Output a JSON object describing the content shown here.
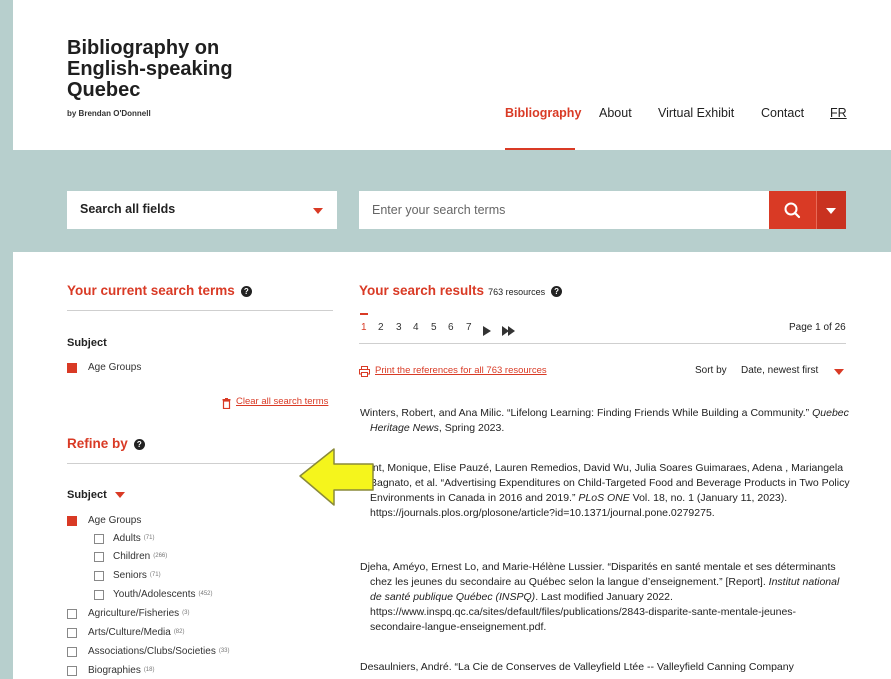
{
  "header": {
    "title": "Bibliography on English-speaking Quebec",
    "byline": "by Brendan O'Donnell",
    "nav": [
      "Bibliography",
      "About",
      "Virtual Exhibit",
      "Contact",
      "FR"
    ]
  },
  "search": {
    "field_select": "Search all fields",
    "placeholder": "Enter your search terms"
  },
  "current_terms": {
    "heading": "Your current search terms",
    "group_label": "Subject",
    "term": "Age Groups",
    "clear_label": "Clear all search terms"
  },
  "refine": {
    "heading": "Refine by",
    "subject_label": "Subject",
    "selected_group": "Age Groups",
    "sub_items": [
      {
        "label": "Adults",
        "count": "(71)"
      },
      {
        "label": "Children",
        "count": "(266)"
      },
      {
        "label": "Seniors",
        "count": "(71)"
      },
      {
        "label": "Youth/Adolescents",
        "count": "(452)"
      }
    ],
    "items": [
      {
        "label": "Agriculture/Fisheries",
        "count": "(3)"
      },
      {
        "label": "Arts/Culture/Media",
        "count": "(82)"
      },
      {
        "label": "Associations/Clubs/Societies",
        "count": "(33)"
      },
      {
        "label": "Biographies",
        "count": "(18)"
      }
    ]
  },
  "results": {
    "heading": "Your search results",
    "count": "763 resources",
    "pages": [
      "1",
      "2",
      "3",
      "4",
      "5",
      "6",
      "7"
    ],
    "page_info": "Page 1 of 26",
    "print_link": "Print the references for all 763 resources",
    "sort_label": "Sort by",
    "sort_value": "Date, newest first",
    "entries": [
      {
        "before": "Winters, Robert, and Ana Milic. “Lifelong Learning: Finding Friends While Building a Community.” ",
        "italic": "Quebec Heritage News",
        "after": ", Spring 2023."
      },
      {
        "before": "Kent, Monique, Elise Pauzé, Lauren Remedios, David Wu, Julia Soares Guimaraes, Adena , Mariangela Bagnato, et al. “Advertising Expenditures on Child-Targeted Food and Beverage Products in Two Policy Environments in Canada in 2016 and 2019.” ",
        "italic": "PLoS ONE",
        "after": " Vol. 18, no. 1 (January 11, 2023). https://journals.plos.org/plosone/article?id=10.1371/journal.pone.0279275."
      },
      {
        "before": "Djeha, Améyo, Ernest Lo, and Marie-Hélène Lussier. “Disparités en santé mentale et ses déterminants chez les jeunes du secondaire au Québec selon la langue d’enseignement.” [Report]. ",
        "italic": "Institut national de santé publique Québec (INSPQ)",
        "after": ". Last modified January 2022. https://www.inspq.qc.ca/sites/default/files/publications/2843-disparite-sante-mentale-jeunes-secondaire-langue-enseignement.pdf."
      },
      {
        "before": "Desaulniers, André. “La Cie de Conserves de Valleyfield Ltée -- Valleyfield Canning Company",
        "italic": "",
        "after": ""
      }
    ]
  },
  "colors": {
    "accent": "#d93a25",
    "band": "#b7cfcd",
    "arrow": "#f5f51c"
  }
}
